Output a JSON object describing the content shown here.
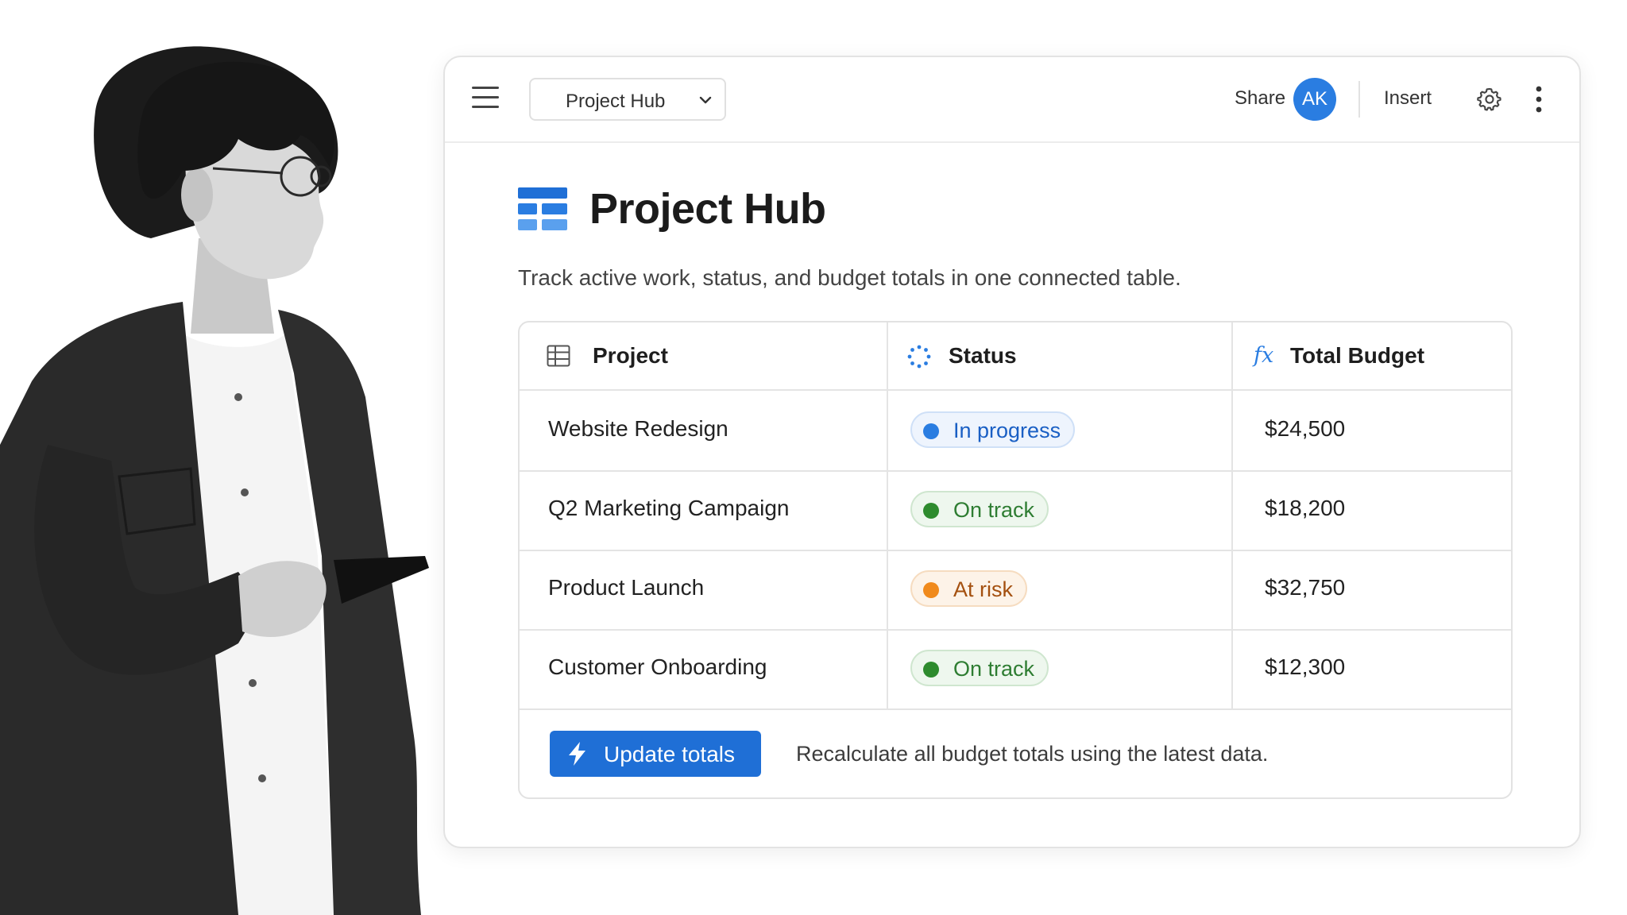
{
  "toolbar": {
    "document_name": "Project Hub",
    "share_label": "Share",
    "avatar_initials": "AK",
    "insert_label": "Insert"
  },
  "page": {
    "title": "Project Hub",
    "subtitle": "Track active work, status, and budget totals in one connected table."
  },
  "table": {
    "columns": [
      {
        "label": "Project",
        "icon": "grid-table-icon"
      },
      {
        "label": "Status",
        "icon": "status-spinner-icon"
      },
      {
        "label": "Total Budget",
        "icon": "formula-fx-icon"
      }
    ],
    "rows": [
      {
        "project": "Website Redesign",
        "status": "In progress",
        "status_kind": "progress",
        "budget": "$24,500"
      },
      {
        "project": "Q2 Marketing Campaign",
        "status": "On track",
        "status_kind": "ontrack",
        "budget": "$18,200"
      },
      {
        "project": "Product Launch",
        "status": "At risk",
        "status_kind": "atrisk",
        "budget": "$32,750"
      },
      {
        "project": "Customer Onboarding",
        "status": "On track",
        "status_kind": "ontrack",
        "budget": "$12,300"
      }
    ]
  },
  "footer": {
    "button_label": "Update totals",
    "note": "Recalculate all budget totals using the latest data."
  },
  "colors": {
    "accent": "#1f6fd6",
    "avatar": "#2a7de1",
    "progress_bg": "#eef4fd",
    "progress_border": "#cfe0f7",
    "progress_text": "#1a5fc4",
    "progress_dot": "#2a7de1",
    "ontrack_bg": "#eef7ee",
    "ontrack_border": "#cfe6cf",
    "ontrack_text": "#2e7d32",
    "ontrack_dot": "#2e8b2e",
    "atrisk_bg": "#fdf3e8",
    "atrisk_border": "#f6dcc0",
    "atrisk_text": "#a4500f",
    "atrisk_dot": "#f08a1c"
  }
}
